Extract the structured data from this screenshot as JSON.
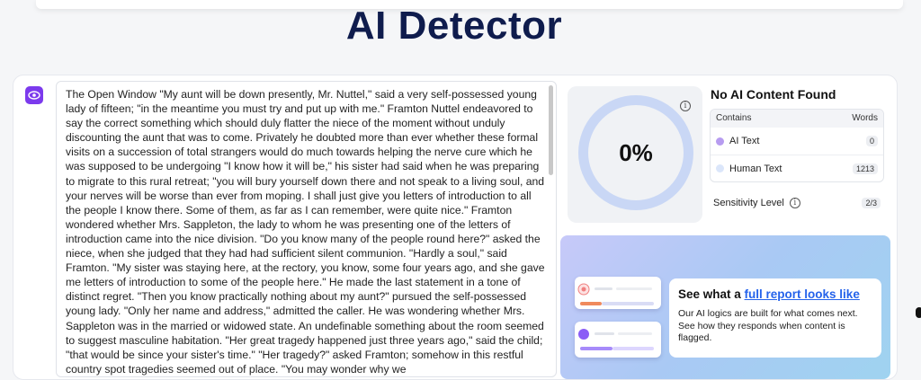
{
  "page": {
    "title": "AI Detector"
  },
  "input": {
    "text": "The Open Window \"My aunt will be down presently, Mr. Nuttel,\" said a very self-possessed young lady of fifteen; \"in the meantime you must try and put up with me.\" Framton Nuttel endeavored to say the correct something which should duly flatter the niece of the moment without unduly discounting the aunt that was to come. Privately he doubted more than ever whether these formal visits on a succession of total strangers would do much towards helping the nerve cure which he was supposed to be undergoing \"I know how it will be,\" his sister had said when he was preparing to migrate to this rural retreat; \"you will bury yourself down there and not speak to a living soul, and your nerves will be worse than ever from moping. I shall just give you letters of introduction to all the people I know there. Some of them, as far as I can remember, were quite nice.\" Framton wondered whether Mrs. Sappleton, the lady to whom he was presenting one of the letters of introduction came into the nice division. \"Do you know many of the people round here?\" asked the niece, when she judged that they had had sufficient silent communion. \"Hardly a soul,\" said Framton. \"My sister was staying here, at the rectory, you know, some four years ago, and she gave me letters of introduction to some of the people here.\" He made the last statement in a tone of distinct regret. \"Then you know practically nothing about my aunt?\" pursued the self-possessed young lady. \"Only her name and address,\" admitted the caller. He was wondering whether Mrs. Sappleton was in the married or widowed state. An undefinable something about the room seemed to suggest masculine habitation. \"Her great tragedy happened just three years ago,\" said the child; \"that would be since your sister's time.\" \"Her tragedy?\" asked Framton; somehow in this restful country spot tragedies seemed out of place. \"You may wonder why we"
  },
  "result": {
    "percent": "0%",
    "ring_color": "#c9d7f5",
    "title": "No AI Content Found",
    "contains_label": "Contains",
    "words_label": "Words",
    "rows": [
      {
        "label": "AI Text",
        "count": "0",
        "dot_color": "#b79cf0"
      },
      {
        "label": "Human Text",
        "count": "1213",
        "dot_color": "#dbe6fa"
      }
    ],
    "sensitivity_label": "Sensitivity Level",
    "sensitivity_value": "2/3"
  },
  "promo": {
    "heading_prefix": "See what a ",
    "heading_link": "full report looks like",
    "description": "Our AI logics are built for what comes next. See how they responds when content is flagged."
  },
  "colors": {
    "accent": "#7c3aed",
    "title": "#0f1c4d",
    "link": "#2563eb"
  }
}
